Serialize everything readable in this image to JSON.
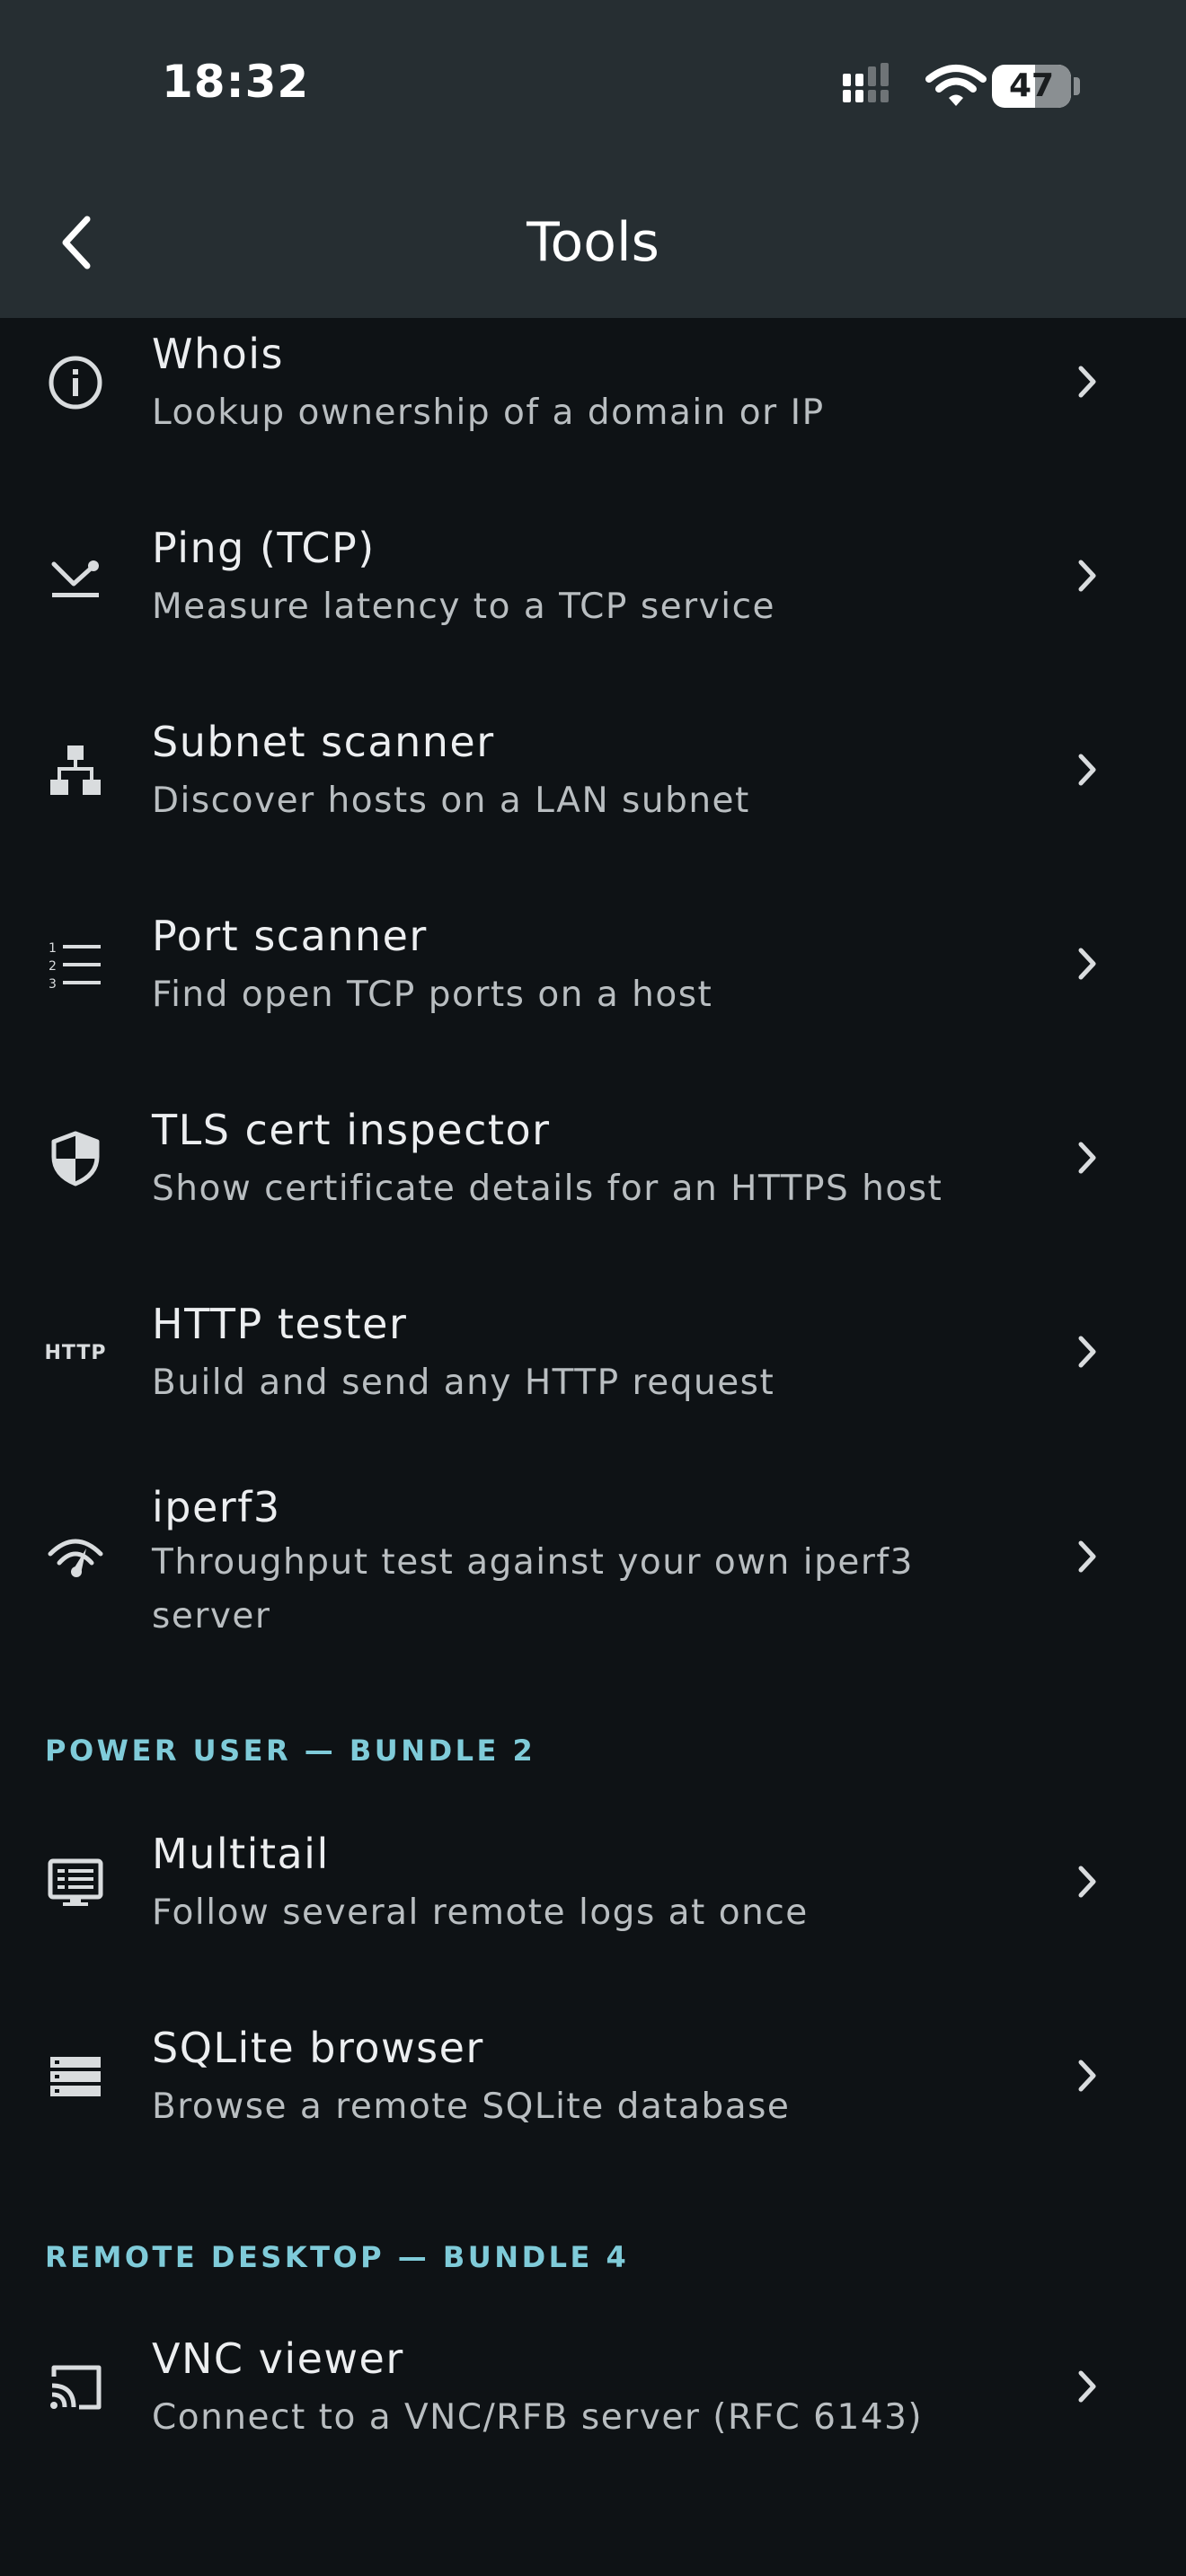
{
  "status_bar": {
    "time": "18:32",
    "battery_level": "47"
  },
  "nav": {
    "title": "Tools",
    "back_icon": "chevron-left-icon"
  },
  "items": [
    {
      "icon": "info-icon",
      "title": "Whois",
      "subtitle": "Lookup ownership of a domain or IP"
    },
    {
      "icon": "ping-icon",
      "title": "Ping (TCP)",
      "subtitle": "Measure latency to a TCP service"
    },
    {
      "icon": "network-tree-icon",
      "title": "Subnet scanner",
      "subtitle": "Discover hosts on a LAN subnet"
    },
    {
      "icon": "numbered-list-icon",
      "title": "Port scanner",
      "subtitle": "Find open TCP ports on a host"
    },
    {
      "icon": "shield-icon",
      "title": "TLS cert inspector",
      "subtitle": "Show certificate details for an HTTPS host"
    },
    {
      "icon": "http-icon",
      "icon_text": "HTTP",
      "title": "HTTP tester",
      "subtitle": "Build and send any HTTP request"
    },
    {
      "icon": "speed-gauge-icon",
      "title": "iperf3",
      "subtitle": "Throughput test against your own iperf3 server"
    }
  ],
  "sections": [
    {
      "header": "POWER USER — BUNDLE 2",
      "items": [
        {
          "icon": "terminal-log-icon",
          "title": "Multitail",
          "subtitle": "Follow several remote logs at once"
        },
        {
          "icon": "database-icon",
          "title": "SQLite browser",
          "subtitle": "Browse a remote SQLite database"
        }
      ]
    },
    {
      "header": "REMOTE DESKTOP — BUNDLE 4",
      "items": [
        {
          "icon": "cast-icon",
          "title": "VNC viewer",
          "subtitle": "Connect to a VNC/RFB server (RFC 6143)"
        }
      ]
    }
  ],
  "colors": {
    "background": "#0e1215",
    "header": "#262e32",
    "section_accent": "#7fcbd9"
  }
}
